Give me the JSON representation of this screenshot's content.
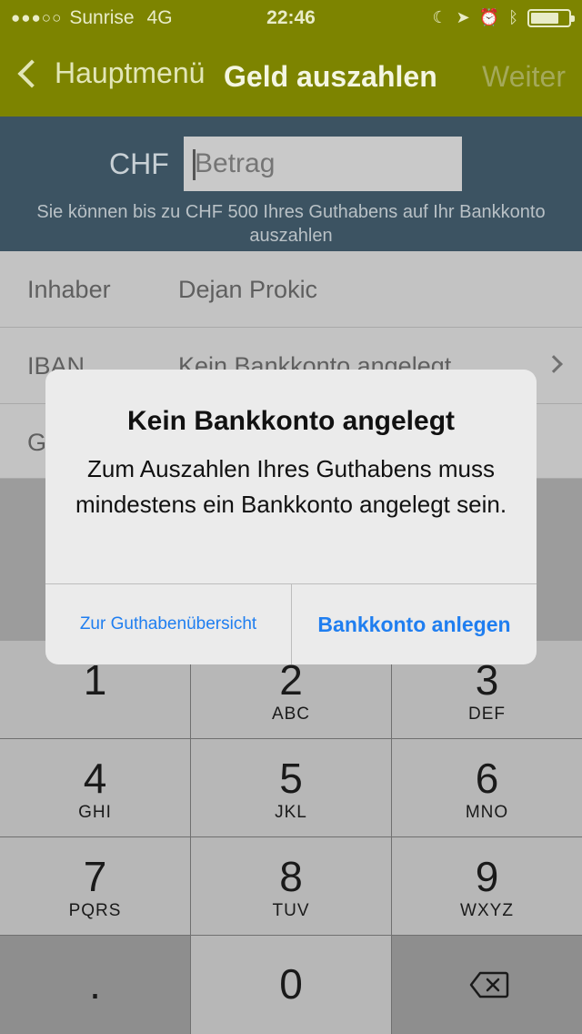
{
  "status_bar": {
    "signal_dots": "●●●○○",
    "carrier": "Sunrise",
    "network": "4G",
    "time": "22:46",
    "icons": [
      "moon-icon",
      "location-icon",
      "alarm-icon",
      "bluetooth-icon",
      "battery-icon"
    ],
    "battery_level": 0.75
  },
  "nav": {
    "back_label": "Hauptmenü",
    "title": "Geld auszahlen",
    "next_label": "Weiter"
  },
  "amount": {
    "currency": "CHF",
    "placeholder": "Betrag",
    "hint": "Sie können bis zu CHF 500 Ihres Guthabens auf Ihr Bankkonto auszahlen"
  },
  "rows": [
    {
      "label": "Inhaber",
      "value": "Dejan Prokic"
    },
    {
      "label": "IBAN",
      "value": "Kein Bankkonto angelegt"
    },
    {
      "label": "G",
      "value": ""
    }
  ],
  "alert": {
    "title": "Kein Bankkonto angelegt",
    "message": "Zum Auszahlen Ihres Guthabens muss mindestens ein Bankkonto angelegt sein.",
    "left_button": "Zur Guthabenübersicht",
    "right_button": "Bankkonto anlegen"
  },
  "keypad": {
    "keys": [
      {
        "num": "1",
        "letters": ""
      },
      {
        "num": "2",
        "letters": "ABC"
      },
      {
        "num": "3",
        "letters": "DEF"
      },
      {
        "num": "4",
        "letters": "GHI"
      },
      {
        "num": "5",
        "letters": "JKL"
      },
      {
        "num": "6",
        "letters": "MNO"
      },
      {
        "num": "7",
        "letters": "PQRS"
      },
      {
        "num": "8",
        "letters": "TUV"
      },
      {
        "num": "9",
        "letters": "WXYZ"
      }
    ],
    "decimal": ".",
    "zero": "0",
    "delete_icon": "backspace-icon"
  },
  "colors": {
    "nav_bar": "#7d8400",
    "amount_panel": "#3c5362",
    "alert_button": "#1f7ef0"
  }
}
